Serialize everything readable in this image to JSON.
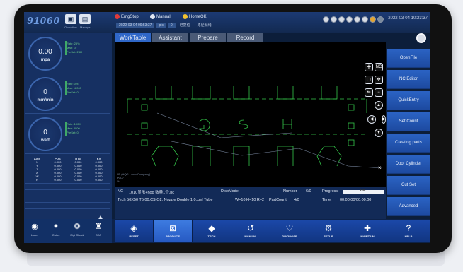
{
  "app": {
    "logo": "91060",
    "datetime": "2022-03-04 10:23:37"
  },
  "top_buttons": [
    {
      "icon": "operation-icon",
      "glyph": "▣",
      "label": "Operation"
    },
    {
      "icon": "manage-icon",
      "glyph": "▤",
      "label": "Manage"
    }
  ],
  "status": {
    "emgstop": "EmgStop",
    "manual": "Manual",
    "homeok": "HomeOK",
    "file_date": "2022-03-04 09:53:37",
    "file_ext": "plc",
    "file_count": "0",
    "file_flag": "已复位",
    "file_state": "路径就绪"
  },
  "meters": [
    {
      "value": "0.00",
      "unit": "mpa",
      "rate": "Rate: 25%",
      "max": "Max: 10",
      "preset": "PreSet: 2.80"
    },
    {
      "value": "0",
      "unit": "mm/min",
      "rate": "Rate: 0%",
      "max": "Max: 12000",
      "preset": "PreSet: 0"
    },
    {
      "value": "0",
      "unit": "watt",
      "rate": "Rate: 100%",
      "max": "Max: 3000",
      "preset": "PreSet: 0"
    }
  ],
  "axis_table": {
    "headers": [
      "AXIS",
      "POS",
      "DTG",
      "KV"
    ],
    "rows": [
      [
        "X",
        "0.000",
        "0.000",
        "0.000"
      ],
      [
        "Y",
        "0.000",
        "0.000",
        "0.000"
      ],
      [
        "Z",
        "0.000",
        "0.000",
        "0.000"
      ],
      [
        "A",
        "0.000",
        "0.000",
        "0.000"
      ],
      [
        "W",
        "0.000",
        "0.000",
        "0.000"
      ],
      [
        "R",
        "0.000",
        "0.000",
        "0.000"
      ]
    ]
  },
  "tabs": [
    "WorkTable",
    "Assistant",
    "Prepare",
    "Record"
  ],
  "canvas": {
    "nc_label": "NC",
    "msg": [
      "U5 (HQG Laser Company)",
      "P0C7",
      "%"
    ]
  },
  "info": {
    "nc_key": "NC",
    "nc_file": "1010显示+hog 数量1个.nc",
    "disp_mode": "DispMode",
    "number_key": "Number",
    "number_val": "6/0",
    "progress_key": "Progress:",
    "progress_pct": "0%",
    "tech_line": "Tech 50X50 T5.00,CS,O2, Nozzle Double 1.0,xml  Tube",
    "dims": "W=10 H=10 R=2",
    "partcount_key": "PartCount",
    "partcount_val": "4/0",
    "time_key": "Time:",
    "time_val": "00:00:00/00:00:00",
    "progress_fraction": 0.0
  },
  "right_buttons": [
    "OpenFile",
    "NC Editor",
    "QuickEntry",
    "Set Count",
    "Creating parts",
    "Door Cylinder",
    "Cut Set",
    "Advanced"
  ],
  "left_bottom": [
    {
      "icon": "laser-icon",
      "glyph": "◉",
      "label": "Laser"
    },
    {
      "icon": "outlet-icon",
      "glyph": "●",
      "label": "Outlet"
    },
    {
      "icon": "digi-chuck-icon",
      "glyph": "❁",
      "label": "Digi Chuck"
    },
    {
      "icon": "gas-icon",
      "glyph": "♜",
      "label": "GAS"
    }
  ],
  "nav": [
    {
      "icon": "reset-icon",
      "glyph": "◈",
      "label": "RESET"
    },
    {
      "icon": "produce-icon",
      "glyph": "⊠",
      "label": "PRODUCE"
    },
    {
      "icon": "tech-icon",
      "glyph": "◆",
      "label": "TECH"
    },
    {
      "icon": "manual-icon",
      "glyph": "↺",
      "label": "MANUAL"
    },
    {
      "icon": "diagnose-icon",
      "glyph": "♡",
      "label": "DIAGNOSE"
    },
    {
      "icon": "setup-icon",
      "glyph": "⚙",
      "label": "SETUP"
    },
    {
      "icon": "maintain-icon",
      "glyph": "✚",
      "label": "MAINTAIN"
    },
    {
      "icon": "help-icon",
      "glyph": "?",
      "label": "HELP"
    }
  ],
  "colors": {
    "accent": "#2f67c8",
    "panel": "#163062",
    "drawing": "#35c84a",
    "emg": "#e03b3b"
  }
}
